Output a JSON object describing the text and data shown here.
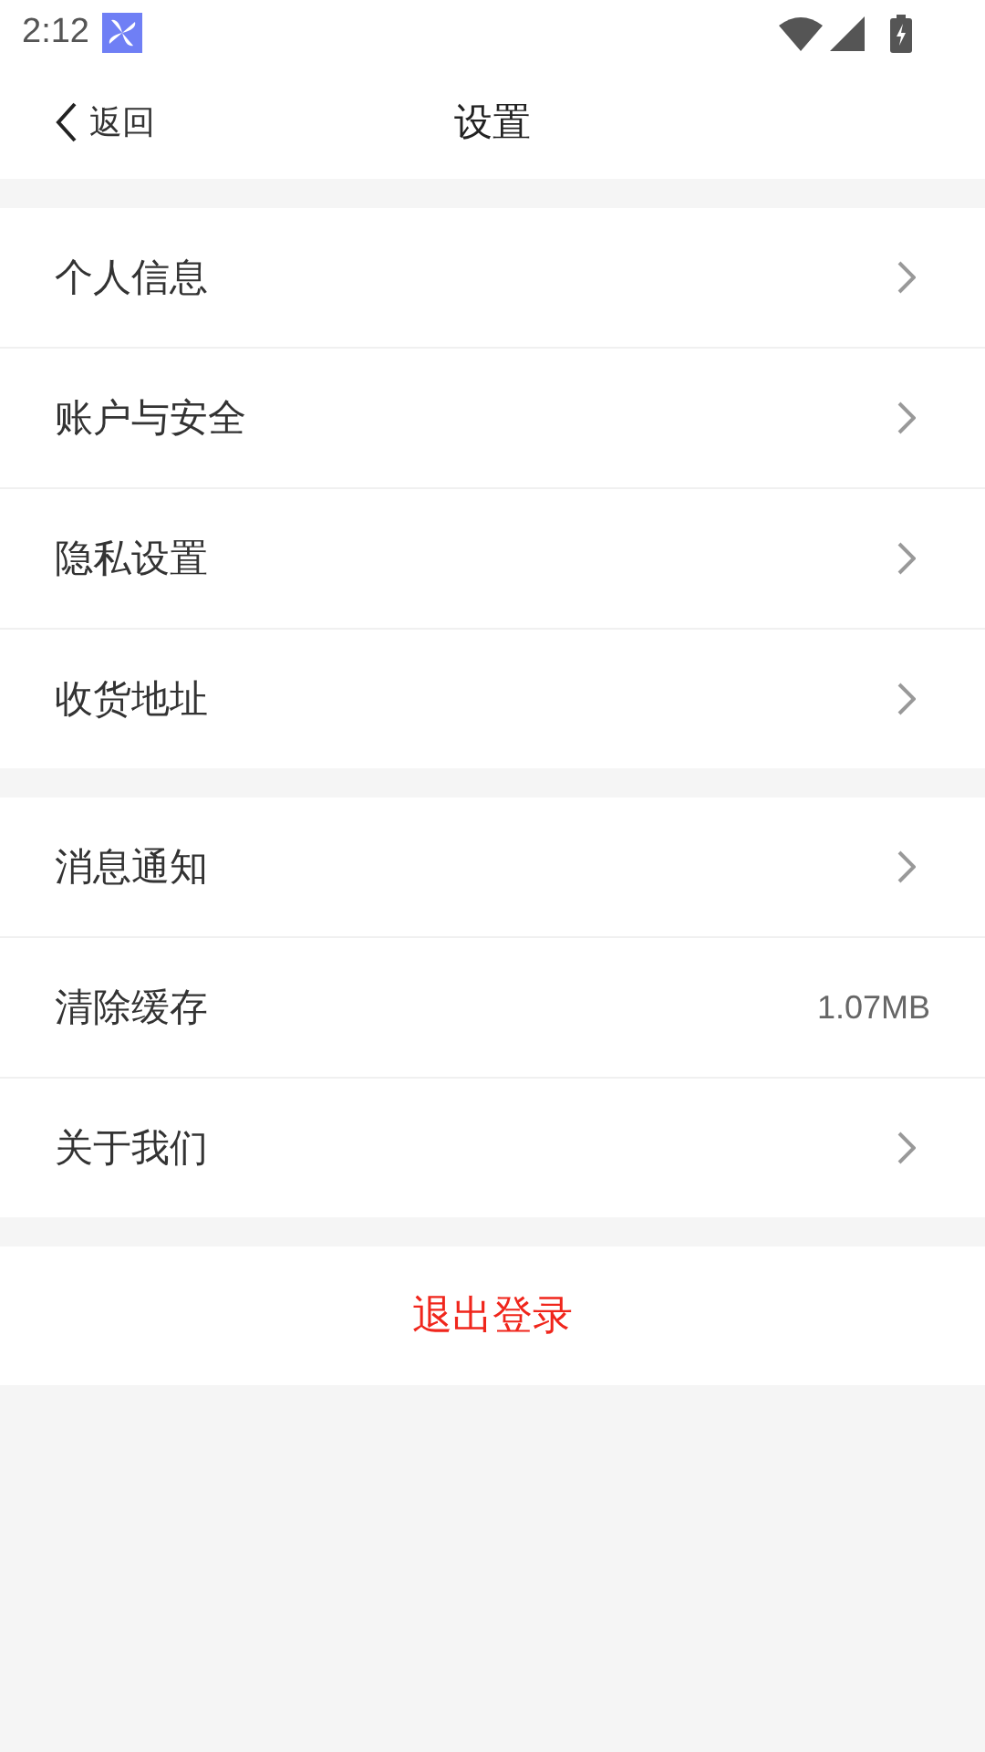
{
  "status_bar": {
    "time": "2:12"
  },
  "nav": {
    "back": "返回",
    "title": "设置"
  },
  "groups": [
    {
      "items": [
        {
          "label": "个人信息",
          "kind": "link"
        },
        {
          "label": "账户与安全",
          "kind": "link"
        },
        {
          "label": "隐私设置",
          "kind": "link"
        },
        {
          "label": "收货地址",
          "kind": "link"
        }
      ]
    },
    {
      "items": [
        {
          "label": "消息通知",
          "kind": "link"
        },
        {
          "label": "清除缓存",
          "kind": "value",
          "value": "1.07MB"
        },
        {
          "label": "关于我们",
          "kind": "link"
        }
      ]
    }
  ],
  "logout": "退出登录"
}
